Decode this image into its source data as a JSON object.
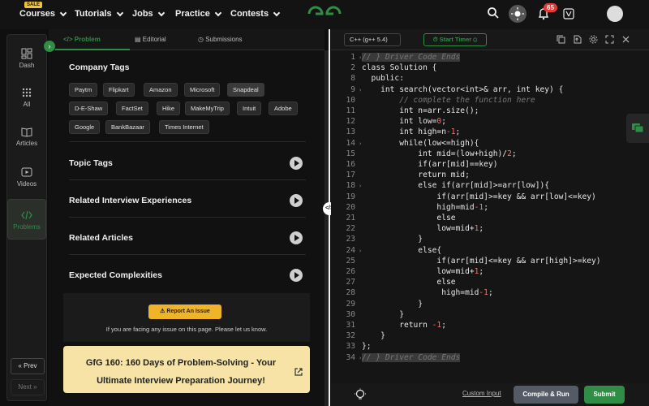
{
  "nav": {
    "sale_badge": "SALE",
    "items": [
      "Courses",
      "Tutorials",
      "Jobs",
      "Practice",
      "Contests"
    ],
    "notification_count": "65"
  },
  "rail": {
    "items": [
      "Dash",
      "All",
      "Articles",
      "Videos",
      "Problems"
    ],
    "prev": "Prev",
    "next": "Next"
  },
  "tabs": [
    "Problem",
    "Editorial",
    "Submissions"
  ],
  "problem": {
    "company_tags_title": "Company Tags",
    "company_tags": [
      "Paytm",
      "Flipkart",
      "Amazon",
      "Microsoft",
      "Snapdeal",
      "D-E-Shaw",
      "FactSet",
      "Hike",
      "MakeMyTrip",
      "Intuit",
      "Adobe",
      "Google",
      "BankBazaar",
      "Times Internet"
    ],
    "sections": [
      "Topic Tags",
      "Related Interview Experiences",
      "Related Articles",
      "Expected Complexities"
    ],
    "report_button": "Report An Issue",
    "report_text": "If you are facing any issue on this page. Please let us know.",
    "promo": "GfG 160: 160 Days of Problem-Solving - Your Ultimate Interview Preparation Journey!"
  },
  "editor": {
    "language": "C++ (g++ 5.4)",
    "timer": "Start Timer",
    "custom_input": "Custom Input",
    "compile": "Compile & Run",
    "submit": "Submit",
    "lines": [
      {
        "n": "1",
        "text": "// } Driver Code Ends",
        "type": "cmt",
        "hl": true,
        "arrow": true
      },
      {
        "n": "2",
        "text": "class Solution {"
      },
      {
        "n": "8",
        "text": "  public:"
      },
      {
        "n": "9",
        "text": "    int search(vector<int>& arr, int key) {",
        "arrow": true
      },
      {
        "n": "10",
        "text": "        // complete the function here",
        "type": "cmt"
      },
      {
        "n": "11",
        "text": "        int n=arr.size();"
      },
      {
        "n": "12",
        "text": "        int low=0;"
      },
      {
        "n": "13",
        "text": "        int high=n-1;"
      },
      {
        "n": "14",
        "text": "        while(low<=high){",
        "arrow": true
      },
      {
        "n": "15",
        "text": "            int mid=(low+high)/2;"
      },
      {
        "n": "16",
        "text": "            if(arr[mid]==key)"
      },
      {
        "n": "17",
        "text": "            return mid;"
      },
      {
        "n": "18",
        "text": "            else if(arr[mid]>=arr[low]){",
        "arrow": true
      },
      {
        "n": "19",
        "text": "                if(arr[mid]>=key && arr[low]<=key)"
      },
      {
        "n": "20",
        "text": "                high=mid-1;"
      },
      {
        "n": "21",
        "text": "                else"
      },
      {
        "n": "22",
        "text": "                low=mid+1;"
      },
      {
        "n": "23",
        "text": "            }"
      },
      {
        "n": "24",
        "text": "            else{",
        "arrow": true
      },
      {
        "n": "25",
        "text": "                if(arr[mid]<=key && arr[high]>=key)"
      },
      {
        "n": "26",
        "text": "                low=mid+1;"
      },
      {
        "n": "27",
        "text": "                else"
      },
      {
        "n": "28",
        "text": "                 high=mid-1;"
      },
      {
        "n": "29",
        "text": "            }"
      },
      {
        "n": "30",
        "text": "        }"
      },
      {
        "n": "31",
        "text": "        return -1;"
      },
      {
        "n": "32",
        "text": "    }"
      },
      {
        "n": "33",
        "text": "};"
      },
      {
        "n": "34",
        "text": "// } Driver Code Ends",
        "type": "cmt",
        "hl": true,
        "arrow": true
      }
    ]
  },
  "colors": {
    "accent_green": "#2f8d46",
    "report_yellow": "#f0b429",
    "promo_bg": "#f6e3a5",
    "notification_red": "#e53935"
  }
}
